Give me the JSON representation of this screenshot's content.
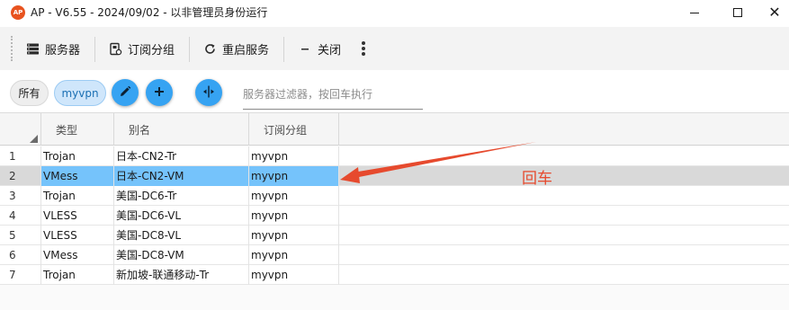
{
  "window": {
    "logo_text": "AP",
    "title": "AP - V6.55 - 2024/09/02 - 以非管理员身份运行"
  },
  "toolbar": {
    "items": [
      {
        "label": "服务器",
        "icon": "server-icon"
      },
      {
        "label": "订阅分组",
        "icon": "subscription-icon"
      },
      {
        "label": "重启服务",
        "icon": "refresh-icon"
      },
      {
        "label": "关闭",
        "icon": "minus-icon"
      }
    ],
    "more_icon": "more-vertical-icon"
  },
  "filter": {
    "chips": [
      "所有",
      "myvpn"
    ],
    "active_chip": "myvpn",
    "buttons": [
      "edit-icon",
      "add-icon",
      "split-icon"
    ],
    "accent_color": "#36a3f2",
    "search_placeholder": "服务器过滤器，按回车执行",
    "search_value": ""
  },
  "table": {
    "columns": [
      "类型",
      "别名",
      "订阅分组"
    ],
    "rows": [
      {
        "num": "1",
        "type": "Trojan",
        "alias": "日本-CN2-Tr",
        "group": "myvpn"
      },
      {
        "num": "2",
        "type": "VMess",
        "alias": "日本-CN2-VM",
        "group": "myvpn"
      },
      {
        "num": "3",
        "type": "Trojan",
        "alias": "美国-DC6-Tr",
        "group": "myvpn"
      },
      {
        "num": "4",
        "type": "VLESS",
        "alias": "美国-DC6-VL",
        "group": "myvpn"
      },
      {
        "num": "5",
        "type": "VLESS",
        "alias": "美国-DC8-VL",
        "group": "myvpn"
      },
      {
        "num": "6",
        "type": "VMess",
        "alias": "美国-DC8-VM",
        "group": "myvpn"
      },
      {
        "num": "7",
        "type": "Trojan",
        "alias": "新加坡-联通移动-Tr",
        "group": "myvpn"
      }
    ],
    "selected_row": "2",
    "selection_color": "#75c3fb"
  },
  "annotation": {
    "text": "回车",
    "color": "#e64a2e"
  }
}
